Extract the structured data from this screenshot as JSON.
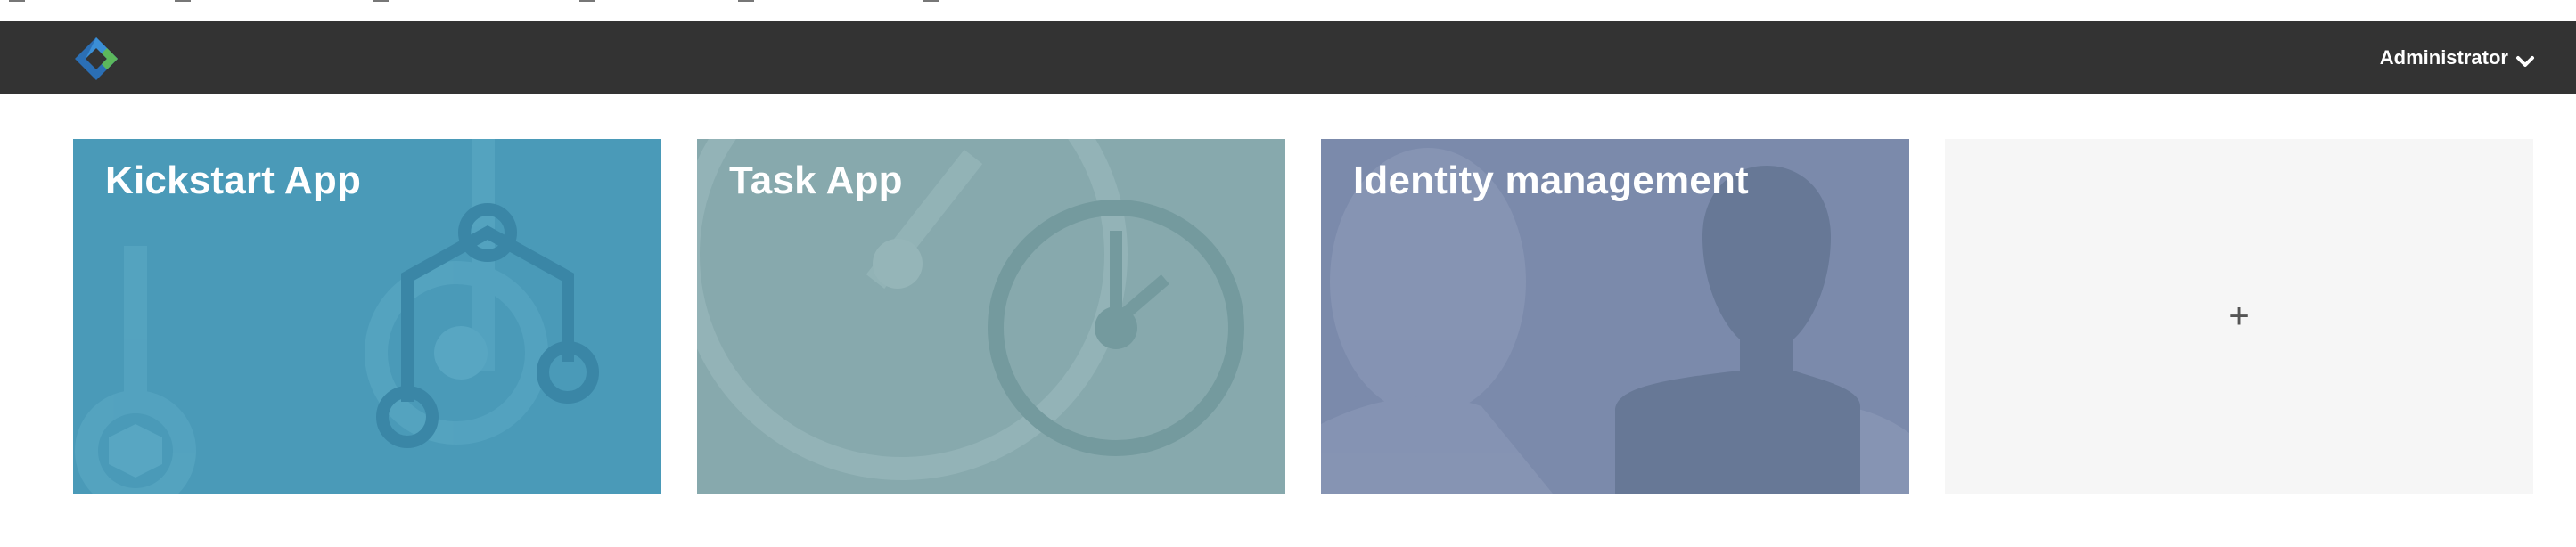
{
  "header": {
    "user_label": "Administrator",
    "logo_icon": "activiti-diamond-logo-icon",
    "dropdown_icon": "chevron-down-icon"
  },
  "apps": [
    {
      "title": "Kickstart App",
      "color": "#4a9ab8",
      "icon": "process-flow-icon"
    },
    {
      "title": "Task App",
      "color": "#87a9ad",
      "icon": "clock-icon"
    },
    {
      "title": "Identity management",
      "color": "#7b8aab",
      "icon": "user-silhouette-icon"
    }
  ],
  "add_tile": {
    "label": "+",
    "color": "#f6f6f6",
    "icon": "plus-icon"
  }
}
